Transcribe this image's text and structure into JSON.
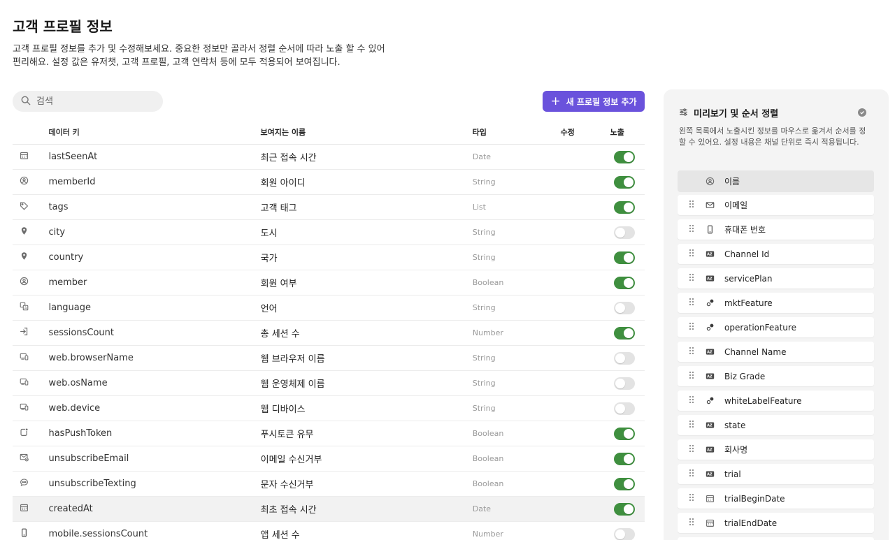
{
  "page": {
    "title": "고객 프로필 정보",
    "description": "고객 프로필 정보를 추가 및 수정해보세요. 중요한 정보만 골라서 정렬 순서에 따라 노출 할 수 있어 편리해요. 설정 값은 유저챗, 고객 프로필, 고객 연락처 등에 모두 적용되어 보여집니다."
  },
  "search": {
    "placeholder": "검색",
    "icon": "search-icon"
  },
  "add_button": {
    "label": "새 프로필 정보 추가",
    "icon": "plus-icon",
    "color": "#6a52dc"
  },
  "table": {
    "columns": {
      "key": "데이터 키",
      "name": "보여지는 이름",
      "type": "타입",
      "edit": "수정",
      "expose": "노출"
    },
    "toggle_on_color": "#3f8f3f",
    "rows": [
      {
        "icon": "calendar-icon",
        "key": "lastSeenAt",
        "name": "최근 접속 시간",
        "type": "Date",
        "exposed": true
      },
      {
        "icon": "user-circle-icon",
        "key": "memberId",
        "name": "회원 아이디",
        "type": "String",
        "exposed": true
      },
      {
        "icon": "tag-icon",
        "key": "tags",
        "name": "고객 태그",
        "type": "List",
        "exposed": true
      },
      {
        "icon": "location-pin-icon",
        "key": "city",
        "name": "도시",
        "type": "String",
        "exposed": false
      },
      {
        "icon": "location-pin-icon",
        "key": "country",
        "name": "국가",
        "type": "String",
        "exposed": true
      },
      {
        "icon": "user-circle-icon",
        "key": "member",
        "name": "회원 여부",
        "type": "Boolean",
        "exposed": true
      },
      {
        "icon": "translate-icon",
        "key": "language",
        "name": "언어",
        "type": "String",
        "exposed": false
      },
      {
        "icon": "sign-in-icon",
        "key": "sessionsCount",
        "name": "총 세션 수",
        "type": "Number",
        "exposed": true
      },
      {
        "icon": "devices-icon",
        "key": "web.browserName",
        "name": "웹 브라우저 이름",
        "type": "String",
        "exposed": false
      },
      {
        "icon": "devices-icon",
        "key": "web.osName",
        "name": "웹 운영체제 이름",
        "type": "String",
        "exposed": false
      },
      {
        "icon": "devices-icon",
        "key": "web.device",
        "name": "웹 디바이스",
        "type": "String",
        "exposed": false
      },
      {
        "icon": "push-badge-icon",
        "key": "hasPushToken",
        "name": "푸시토큰 유무",
        "type": "Boolean",
        "exposed": true
      },
      {
        "icon": "mail-off-icon",
        "key": "unsubscribeEmail",
        "name": "이메일 수신거부",
        "type": "Boolean",
        "exposed": true
      },
      {
        "icon": "chat-off-icon",
        "key": "unsubscribeTexting",
        "name": "문자 수신거부",
        "type": "Boolean",
        "exposed": true
      },
      {
        "icon": "calendar-icon",
        "key": "createdAt",
        "name": "최초 접속 시간",
        "type": "Date",
        "exposed": true,
        "highlighted": true
      },
      {
        "icon": "mobile-icon",
        "key": "mobile.sessionsCount",
        "name": "앱 세션 수",
        "type": "Number",
        "exposed": false
      }
    ]
  },
  "panel": {
    "title": "미리보기 및 순서 정렬",
    "title_icon": "sliders-icon",
    "check_icon": "check-circle-icon",
    "description": "왼쪽 목록에서 노출시킨 정보를 마우스로 옮겨서 순서를 정할 수 있어요. 설정 내용은 채널 단위로 즉시 적용됩니다.",
    "items": [
      {
        "icon": "user-circle-icon",
        "label": "이름",
        "fixed": true
      },
      {
        "icon": "mail-icon",
        "label": "이메일"
      },
      {
        "icon": "mobile-icon",
        "label": "휴대폰 번호"
      },
      {
        "icon": "text-field-icon",
        "label": "Channel Id"
      },
      {
        "icon": "text-field-icon",
        "label": "servicePlan"
      },
      {
        "icon": "toggle-dots-icon",
        "label": "mktFeature"
      },
      {
        "icon": "toggle-dots-icon",
        "label": "operationFeature"
      },
      {
        "icon": "text-field-icon",
        "label": "Channel Name"
      },
      {
        "icon": "text-field-icon",
        "label": "Biz Grade"
      },
      {
        "icon": "toggle-dots-icon",
        "label": "whiteLabelFeature"
      },
      {
        "icon": "text-field-icon",
        "label": "state"
      },
      {
        "icon": "text-field-icon",
        "label": "회사명"
      },
      {
        "icon": "text-field-icon",
        "label": "trial"
      },
      {
        "icon": "calendar-icon",
        "label": "trialBeginDate"
      },
      {
        "icon": "calendar-icon",
        "label": "trialEndDate"
      },
      {
        "icon": "text-field-icon",
        "label": ""
      }
    ]
  }
}
